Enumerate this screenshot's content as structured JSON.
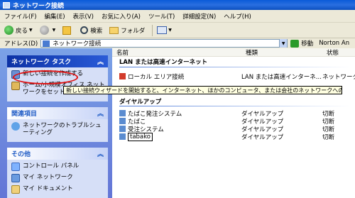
{
  "window": {
    "title": "ネットワーク接続"
  },
  "menu": [
    "ファイル(F)",
    "編集(E)",
    "表示(V)",
    "お気に入り(A)",
    "ツール(T)",
    "詳細設定(N)",
    "ヘルプ(H)"
  ],
  "toolbar": {
    "back_label": "戻る",
    "search_label": "検索",
    "folders_label": "フォルダ"
  },
  "address": {
    "label": "アドレス(D)",
    "value": "ネットワーク接続",
    "go_label": "移動",
    "extra": "Norton An"
  },
  "sidebar": {
    "network_tasks": {
      "title": "ネットワーク タスク",
      "items": [
        "新しい接続を作成する",
        "ホーム/小規模オフィス ネットワークをセットアップする"
      ]
    },
    "related": {
      "title": "関連項目",
      "items": [
        "ネットワークのトラブルシューティング"
      ]
    },
    "other": {
      "title": "その他",
      "items": [
        "コントロール パネル",
        "マイ ネットワーク",
        "マイ ドキュメント"
      ]
    }
  },
  "content": {
    "columns": [
      "名前",
      "種類",
      "状態"
    ],
    "group_lan": "LAN または高速インターネット",
    "lan_row": {
      "name": "ローカル エリア接続",
      "type": "LAN または高速インターネ...",
      "status": "ネットワーク ケーブル"
    },
    "group_dialup": "ダイヤルアップ",
    "dialup_rows": [
      {
        "name": "たばこ発注システム",
        "type": "ダイヤルアップ",
        "status": "切断"
      },
      {
        "name": "たばこ",
        "type": "ダイヤルアップ",
        "status": "切断"
      },
      {
        "name": "受注システム",
        "type": "ダイヤルアップ",
        "status": "切断"
      },
      {
        "name": "tabako",
        "type": "ダイヤルアップ",
        "status": "切断"
      }
    ]
  },
  "tooltip": "新しい接続ウィザードを開始すると、インターネット、ほかのコンピュータ、または会社のネットワークへの接続を作成できます。"
}
